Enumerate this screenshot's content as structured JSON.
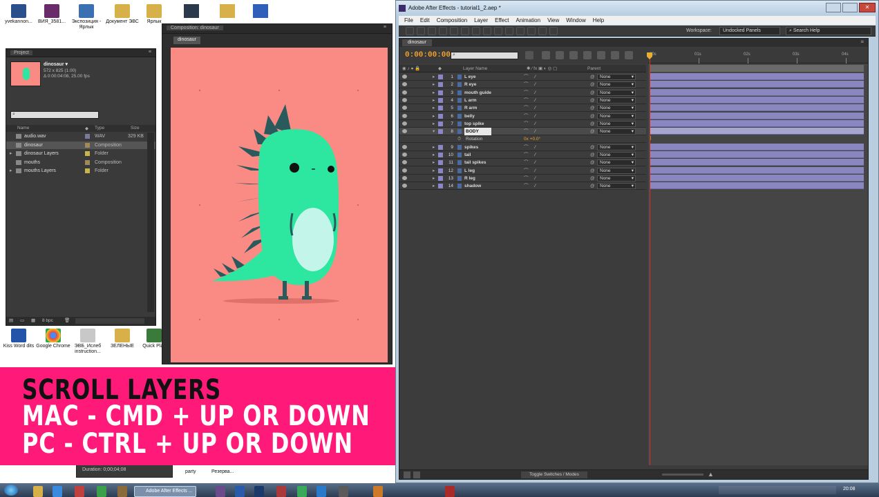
{
  "desktop": {
    "top_icons": [
      "уvekannon...",
      "ВИЯ_3581...",
      "Экспозиция - Ярлык",
      "Документ ЭВС",
      "Ярлык"
    ],
    "bottom_icons": [
      "Kiss Word dits",
      "Google Chrome",
      "ЭВБ_Ислеб instruction...",
      "ЗЕЛЕНЫЕ",
      "Quick Play"
    ],
    "small_items": [
      "party",
      "Резерва..."
    ],
    "duration_label": "Duration: 0;00;04;08"
  },
  "project_panel": {
    "title": "Project",
    "item_name": "dinosaur ▾",
    "item_info_1": "572 x 825 (1.00)",
    "item_info_2": "Δ 0:00:04:08, 25.00 fps",
    "search_placeholder": "",
    "col_name": "Name",
    "col_type": "Type",
    "col_size": "Size",
    "items": [
      {
        "name": "audio.wav",
        "type": "WAV",
        "size": "329 KB",
        "color": "#7a7a9c"
      },
      {
        "name": "dinosaur",
        "type": "Composition",
        "size": "",
        "color": "#a08a5a"
      },
      {
        "name": "dinosaur Layers",
        "type": "Folder",
        "size": "",
        "color": "#c8b44a"
      },
      {
        "name": "mouths",
        "type": "Composition",
        "size": "",
        "color": "#a08a5a"
      },
      {
        "name": "mouths Layers",
        "type": "Folder",
        "size": "",
        "color": "#c8b44a"
      }
    ],
    "bpc": "8 bpc"
  },
  "comp_panel": {
    "title": "Composition: dinosaur",
    "tab": "dinosaur",
    "bg_color": "#fa8b84",
    "dino_color": "#2de6a0",
    "spike_color": "#2a5a5c",
    "belly_color": "#c4f5ea"
  },
  "ae_window": {
    "title": "Adobe After Effects - tutorial1_2.aep *",
    "menu": [
      "File",
      "Edit",
      "Composition",
      "Layer",
      "Effect",
      "Animation",
      "View",
      "Window",
      "Help"
    ],
    "workspace_label": "Workspace:",
    "workspace_value": "Undocked Panels",
    "search_help": "Search Help",
    "timeline_tab": "dinosaur",
    "timecode": "0:00:00:00",
    "col_layer_name": "Layer Name",
    "col_parent": "Parent",
    "time_ticks": [
      "00s",
      "01s",
      "02s",
      "03s",
      "04s"
    ],
    "layers": [
      {
        "num": "1",
        "name": "L eye",
        "parent": "None",
        "color": "#8a86c8"
      },
      {
        "num": "2",
        "name": "R eye",
        "parent": "None",
        "color": "#8a86c8"
      },
      {
        "num": "3",
        "name": "mouth guide",
        "parent": "None",
        "color": "#8a86c8"
      },
      {
        "num": "4",
        "name": "L arm",
        "parent": "None",
        "color": "#8a86c8"
      },
      {
        "num": "5",
        "name": "R arm",
        "parent": "None",
        "color": "#8a86c8"
      },
      {
        "num": "6",
        "name": "belly",
        "parent": "None",
        "color": "#8a86c8"
      },
      {
        "num": "7",
        "name": "top spike",
        "parent": "None",
        "color": "#8a86c8"
      },
      {
        "num": "8",
        "name": "BODY",
        "parent": "None",
        "color": "#8a86c8"
      },
      {
        "num": "9",
        "name": "spikes",
        "parent": "None",
        "color": "#8a86c8"
      },
      {
        "num": "10",
        "name": "tail",
        "parent": "None",
        "color": "#8a86c8"
      },
      {
        "num": "11",
        "name": "tail spikes",
        "parent": "None",
        "color": "#8a86c8"
      },
      {
        "num": "12",
        "name": "L leg",
        "parent": "None",
        "color": "#8a86c8"
      },
      {
        "num": "13",
        "name": "R leg",
        "parent": "None",
        "color": "#8a86c8"
      },
      {
        "num": "14",
        "name": "shadow",
        "parent": "None",
        "color": "#8a86c8"
      }
    ],
    "rotation_label": "Rotation",
    "rotation_value": "0x +0.0°",
    "toggle_label": "Toggle Switches / Modes"
  },
  "overlay": {
    "line1": "SCROLL LAYERS",
    "line2": "MAC - CMD + UP OR DOWN",
    "line3": "PC - CTRL + UP OR DOWN",
    "bg_color": "#ff1a7a"
  },
  "taskbar": {
    "active_app": "Adobe After Effects ...",
    "clock": "20:08"
  }
}
